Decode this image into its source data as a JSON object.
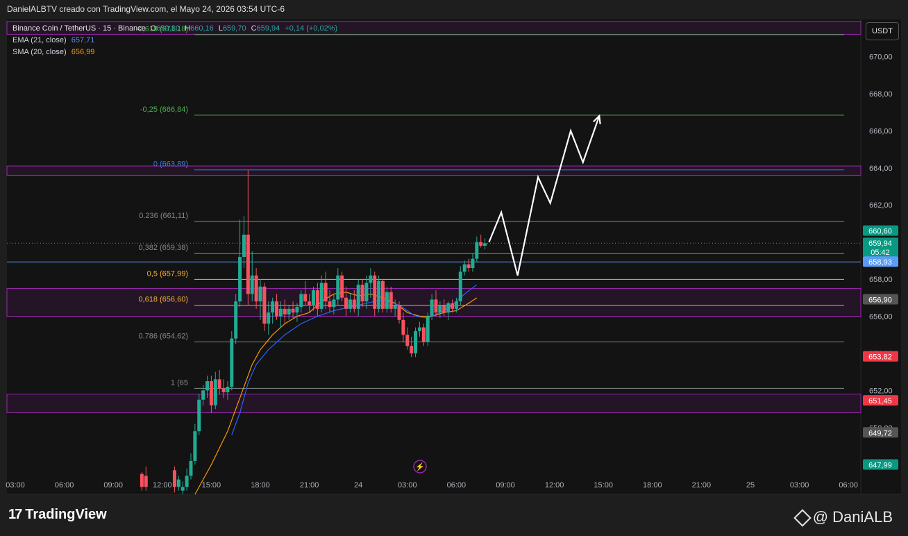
{
  "header": {
    "attribution": "DanielALBTV creado con TradingView.com, el Mayo 24, 2026 03:54 UTC-6"
  },
  "legend": {
    "symbol": "Binance Coin / TetherUS · 15 · Binance",
    "ohlc": {
      "o_label": "O",
      "o": "659,80",
      "h_label": "H",
      "h": "660,16",
      "l_label": "L",
      "l": "659,70",
      "c_label": "C",
      "c": "659,94",
      "change": "+0,14 (+0,02%)"
    },
    "ema": {
      "label": "EMA (21, close)",
      "value": "657,71"
    },
    "sma": {
      "label": "SMA (20, close)",
      "value": "656,99"
    }
  },
  "unit_button": "USDT",
  "footer": {
    "brand": "TradingView",
    "brand_mark": "17",
    "author": "@ DaniALB"
  },
  "colors": {
    "background": "#131313",
    "up": "#22ab94",
    "down": "#f7525f",
    "ema": "#2962ff",
    "sma": "#ff9800",
    "zone": "#9c27b0",
    "fib_green": "#4caf50",
    "fib_blue": "#3a7ff0",
    "fib_orange": "#f5b335",
    "projection": "#ffffff",
    "price_green": "#089981"
  },
  "icons": {
    "flash": "lightning-icon"
  },
  "chart_data": {
    "type": "candlestick",
    "y_axis": {
      "min": 646.4,
      "max": 672.0,
      "ticks": [
        "670,00",
        "668,00",
        "666,00",
        "664,00",
        "662,00",
        "660,00",
        "658,00",
        "656,00",
        "654,00",
        "652,00",
        "650,00"
      ]
    },
    "x_axis": {
      "ticks": [
        "03:00",
        "06:00",
        "09:00",
        "12:00",
        "15:00",
        "18:00",
        "21:00",
        "24",
        "03:00",
        "06:00",
        "09:00",
        "12:00",
        "15:00",
        "18:00",
        "21:00",
        "25",
        "03:00",
        "06:00"
      ]
    },
    "candles": [
      {
        "t": 7.75,
        "o": 647.5,
        "h": 647.6,
        "l": 646.6,
        "c": 646.8
      },
      {
        "t": 8.0,
        "o": 647.4,
        "h": 647.9,
        "l": 646.6,
        "c": 646.8
      },
      {
        "t": 9.75,
        "o": 647.7,
        "h": 647.9,
        "l": 646.5,
        "c": 646.8
      },
      {
        "t": 10.0,
        "o": 646.8,
        "h": 647.4,
        "l": 646.6,
        "c": 647.2
      },
      {
        "t": 10.25,
        "o": 646.6,
        "h": 647.1,
        "l": 646.4,
        "c": 646.8
      },
      {
        "t": 10.5,
        "o": 646.8,
        "h": 647.8,
        "l": 646.6,
        "c": 647.4
      },
      {
        "t": 10.75,
        "o": 647.4,
        "h": 648.6,
        "l": 647.2,
        "c": 648.2
      },
      {
        "t": 11.0,
        "o": 648.2,
        "h": 650.2,
        "l": 648.0,
        "c": 649.8
      },
      {
        "t": 11.25,
        "o": 649.8,
        "h": 651.8,
        "l": 649.6,
        "c": 651.5
      },
      {
        "t": 11.5,
        "o": 651.5,
        "h": 652.3,
        "l": 651.2,
        "c": 652.0
      },
      {
        "t": 11.75,
        "o": 652.0,
        "h": 652.8,
        "l": 651.6,
        "c": 652.5
      },
      {
        "t": 12.0,
        "o": 652.5,
        "h": 652.8,
        "l": 650.8,
        "c": 651.2
      },
      {
        "t": 12.25,
        "o": 651.2,
        "h": 653.0,
        "l": 651.0,
        "c": 652.6
      },
      {
        "t": 12.5,
        "o": 652.6,
        "h": 653.1,
        "l": 651.8,
        "c": 652.1
      },
      {
        "t": 12.75,
        "o": 652.1,
        "h": 652.6,
        "l": 651.6,
        "c": 651.9
      },
      {
        "t": 13.0,
        "o": 651.9,
        "h": 652.5,
        "l": 651.5,
        "c": 652.2
      },
      {
        "t": 13.25,
        "o": 652.2,
        "h": 655.2,
        "l": 652.0,
        "c": 654.8
      },
      {
        "t": 13.5,
        "o": 654.8,
        "h": 657.2,
        "l": 654.5,
        "c": 656.8
      },
      {
        "t": 13.75,
        "o": 656.8,
        "h": 661.2,
        "l": 656.5,
        "c": 659.2
      },
      {
        "t": 14.0,
        "o": 659.2,
        "h": 661.4,
        "l": 658.6,
        "c": 660.4
      },
      {
        "t": 14.25,
        "o": 660.4,
        "h": 663.9,
        "l": 656.6,
        "c": 657.2
      },
      {
        "t": 14.5,
        "o": 657.2,
        "h": 659.5,
        "l": 656.8,
        "c": 658.2
      },
      {
        "t": 14.75,
        "o": 658.2,
        "h": 658.6,
        "l": 656.4,
        "c": 656.8
      },
      {
        "t": 15.0,
        "o": 656.8,
        "h": 658.0,
        "l": 655.8,
        "c": 657.6
      },
      {
        "t": 15.25,
        "o": 657.6,
        "h": 657.8,
        "l": 655.2,
        "c": 655.6
      },
      {
        "t": 15.5,
        "o": 655.6,
        "h": 656.8,
        "l": 655.0,
        "c": 656.2
      },
      {
        "t": 15.75,
        "o": 656.2,
        "h": 657.0,
        "l": 655.6,
        "c": 656.8
      },
      {
        "t": 16.0,
        "o": 656.8,
        "h": 657.2,
        "l": 655.8,
        "c": 656.0
      },
      {
        "t": 16.25,
        "o": 656.0,
        "h": 656.8,
        "l": 655.4,
        "c": 656.4
      },
      {
        "t": 16.5,
        "o": 656.4,
        "h": 656.9,
        "l": 655.6,
        "c": 656.1
      },
      {
        "t": 16.75,
        "o": 656.1,
        "h": 656.6,
        "l": 655.8,
        "c": 656.4
      },
      {
        "t": 17.0,
        "o": 656.4,
        "h": 656.8,
        "l": 655.9,
        "c": 656.2
      },
      {
        "t": 17.25,
        "o": 656.2,
        "h": 656.7,
        "l": 655.7,
        "c": 656.5
      },
      {
        "t": 17.5,
        "o": 656.5,
        "h": 657.4,
        "l": 656.2,
        "c": 657.2
      },
      {
        "t": 17.75,
        "o": 657.2,
        "h": 657.9,
        "l": 656.6,
        "c": 656.8
      },
      {
        "t": 18.0,
        "o": 656.8,
        "h": 657.2,
        "l": 656.2,
        "c": 656.6
      },
      {
        "t": 18.25,
        "o": 656.6,
        "h": 657.6,
        "l": 656.3,
        "c": 657.4
      },
      {
        "t": 18.5,
        "o": 657.4,
        "h": 657.8,
        "l": 656.0,
        "c": 656.4
      },
      {
        "t": 18.75,
        "o": 656.4,
        "h": 658.2,
        "l": 656.2,
        "c": 657.8
      },
      {
        "t": 19.0,
        "o": 657.8,
        "h": 658.4,
        "l": 656.4,
        "c": 656.8
      },
      {
        "t": 19.25,
        "o": 656.8,
        "h": 657.4,
        "l": 656.2,
        "c": 656.5
      },
      {
        "t": 19.5,
        "o": 656.5,
        "h": 657.2,
        "l": 656.1,
        "c": 656.9
      },
      {
        "t": 19.75,
        "o": 656.9,
        "h": 658.6,
        "l": 656.6,
        "c": 658.2
      },
      {
        "t": 20.0,
        "o": 658.2,
        "h": 658.4,
        "l": 656.8,
        "c": 657.0
      },
      {
        "t": 20.25,
        "o": 657.0,
        "h": 657.6,
        "l": 656.0,
        "c": 656.4
      },
      {
        "t": 20.5,
        "o": 656.4,
        "h": 657.2,
        "l": 656.2,
        "c": 656.9
      },
      {
        "t": 20.75,
        "o": 656.9,
        "h": 657.4,
        "l": 656.2,
        "c": 656.4
      },
      {
        "t": 21.0,
        "o": 656.4,
        "h": 658.0,
        "l": 656.0,
        "c": 657.7
      },
      {
        "t": 21.25,
        "o": 657.7,
        "h": 658.0,
        "l": 656.5,
        "c": 656.8
      },
      {
        "t": 21.5,
        "o": 656.8,
        "h": 658.2,
        "l": 656.4,
        "c": 657.8
      },
      {
        "t": 21.75,
        "o": 657.8,
        "h": 658.6,
        "l": 657.0,
        "c": 658.2
      },
      {
        "t": 22.0,
        "o": 658.2,
        "h": 658.4,
        "l": 656.0,
        "c": 656.4
      },
      {
        "t": 22.25,
        "o": 656.4,
        "h": 658.2,
        "l": 656.2,
        "c": 657.9
      },
      {
        "t": 22.5,
        "o": 657.9,
        "h": 658.0,
        "l": 656.2,
        "c": 656.4
      },
      {
        "t": 22.75,
        "o": 656.4,
        "h": 657.6,
        "l": 656.2,
        "c": 657.3
      },
      {
        "t": 23.0,
        "o": 657.3,
        "h": 657.6,
        "l": 656.2,
        "c": 656.4
      },
      {
        "t": 23.25,
        "o": 656.4,
        "h": 656.9,
        "l": 656.0,
        "c": 656.6
      },
      {
        "t": 23.5,
        "o": 656.6,
        "h": 656.8,
        "l": 655.6,
        "c": 655.8
      },
      {
        "t": 23.75,
        "o": 655.8,
        "h": 656.2,
        "l": 654.6,
        "c": 655.0
      },
      {
        "t": 24.0,
        "o": 655.0,
        "h": 655.4,
        "l": 654.2,
        "c": 654.4
      },
      {
        "t": 24.25,
        "o": 654.4,
        "h": 654.9,
        "l": 653.8,
        "c": 654.0
      },
      {
        "t": 24.5,
        "o": 654.0,
        "h": 655.4,
        "l": 653.8,
        "c": 655.2
      },
      {
        "t": 24.75,
        "o": 655.2,
        "h": 655.7,
        "l": 654.9,
        "c": 655.4
      },
      {
        "t": 25.0,
        "o": 655.4,
        "h": 655.6,
        "l": 654.4,
        "c": 654.6
      },
      {
        "t": 25.25,
        "o": 654.6,
        "h": 656.2,
        "l": 654.4,
        "c": 656.0
      },
      {
        "t": 25.5,
        "o": 656.0,
        "h": 657.2,
        "l": 655.8,
        "c": 656.9
      },
      {
        "t": 25.75,
        "o": 656.9,
        "h": 657.4,
        "l": 656.0,
        "c": 656.2
      },
      {
        "t": 26.0,
        "o": 656.2,
        "h": 656.8,
        "l": 655.9,
        "c": 656.6
      },
      {
        "t": 26.25,
        "o": 656.6,
        "h": 656.9,
        "l": 656.0,
        "c": 656.2
      },
      {
        "t": 26.5,
        "o": 656.2,
        "h": 656.8,
        "l": 655.8,
        "c": 656.7
      },
      {
        "t": 26.75,
        "o": 656.7,
        "h": 656.9,
        "l": 656.2,
        "c": 656.4
      },
      {
        "t": 27.0,
        "o": 656.4,
        "h": 657.0,
        "l": 656.2,
        "c": 656.8
      },
      {
        "t": 27.25,
        "o": 656.8,
        "h": 658.7,
        "l": 656.6,
        "c": 658.4
      },
      {
        "t": 27.5,
        "o": 658.4,
        "h": 659.0,
        "l": 658.2,
        "c": 658.8
      },
      {
        "t": 27.75,
        "o": 658.8,
        "h": 659.1,
        "l": 658.4,
        "c": 658.6
      },
      {
        "t": 28.0,
        "o": 658.6,
        "h": 659.4,
        "l": 658.4,
        "c": 659.1
      },
      {
        "t": 28.25,
        "o": 659.1,
        "h": 660.3,
        "l": 658.9,
        "c": 660.0
      },
      {
        "t": 28.5,
        "o": 660.0,
        "h": 660.4,
        "l": 659.7,
        "c": 659.8
      },
      {
        "t": 28.75,
        "o": 659.8,
        "h": 660.2,
        "l": 659.6,
        "c": 659.94
      }
    ],
    "ema": [
      [
        13.25,
        649.6
      ],
      [
        13.75,
        650.8
      ],
      [
        14.25,
        652.4
      ],
      [
        14.75,
        653.4
      ],
      [
        15.5,
        654.2
      ],
      [
        16.5,
        655.0
      ],
      [
        17.5,
        655.6
      ],
      [
        18.5,
        656.0
      ],
      [
        19.5,
        656.3
      ],
      [
        20.5,
        656.5
      ],
      [
        21.5,
        656.7
      ],
      [
        22.5,
        656.9
      ],
      [
        23.5,
        656.6
      ],
      [
        24.5,
        656.0
      ],
      [
        25.25,
        655.9
      ],
      [
        26.0,
        656.2
      ],
      [
        26.75,
        656.6
      ],
      [
        27.5,
        657.2
      ],
      [
        28.25,
        657.7
      ]
    ],
    "sma": [
      [
        11.0,
        646.4
      ],
      [
        12.0,
        648.0
      ],
      [
        13.0,
        649.8
      ],
      [
        13.5,
        651.0
      ],
      [
        14.0,
        652.2
      ],
      [
        14.5,
        653.4
      ],
      [
        15.0,
        654.2
      ],
      [
        15.75,
        655.0
      ],
      [
        16.5,
        655.6
      ],
      [
        17.25,
        656.0
      ],
      [
        18.0,
        656.2
      ],
      [
        18.75,
        656.8
      ],
      [
        19.5,
        657.2
      ],
      [
        20.25,
        657.3
      ],
      [
        21.0,
        657.1
      ],
      [
        21.75,
        657.2
      ],
      [
        22.5,
        657.0
      ],
      [
        23.25,
        656.7
      ],
      [
        24.0,
        656.2
      ],
      [
        24.75,
        656.0
      ],
      [
        25.5,
        656.0
      ],
      [
        26.25,
        656.2
      ],
      [
        27.0,
        656.3
      ],
      [
        27.75,
        656.7
      ],
      [
        28.25,
        656.99
      ]
    ],
    "fib_levels": [
      {
        "label": "-0,618 (671,18)",
        "price": 671.18,
        "color": "#4caf50"
      },
      {
        "label": "-0,25 (666,84)",
        "price": 666.84,
        "color": "#4caf50"
      },
      {
        "label": "0 (663,89)",
        "price": 663.89,
        "color": "#3a7ff0"
      },
      {
        "label": "0.236 (661,11)",
        "price": 661.11,
        "color": "#888888"
      },
      {
        "label": "0,382 (659,38)",
        "price": 659.38,
        "color": "#888888"
      },
      {
        "label": "0,5 (657,99)",
        "price": 657.99,
        "color": "#f5b335"
      },
      {
        "label": "0,618 (656,60)",
        "price": 656.6,
        "color": "#f5b335"
      },
      {
        "label": "0.786 (654,62)",
        "price": 654.62,
        "color": "#888888"
      },
      {
        "label": "1 (65",
        "price": 652.11,
        "color": "#888888"
      }
    ],
    "zones": [
      [
        671.2,
        671.9
      ],
      [
        663.6,
        664.1
      ],
      [
        656.0,
        657.5
      ],
      [
        650.8,
        651.8
      ]
    ],
    "horizontal_lines": [
      {
        "price": 658.93,
        "color": "#5b9cf6"
      }
    ],
    "projection": [
      [
        29.0,
        660.0
      ],
      [
        29.75,
        661.6
      ],
      [
        30.75,
        658.2
      ],
      [
        32.0,
        663.5
      ],
      [
        32.75,
        662.1
      ],
      [
        34.0,
        666.0
      ],
      [
        34.75,
        664.3
      ],
      [
        35.75,
        666.8
      ]
    ],
    "price_labels": [
      {
        "price": 660.6,
        "text": "660,60",
        "color": "#089981"
      },
      {
        "price": 659.94,
        "text": "659,94",
        "color": "#089981",
        "extra": "05:42"
      },
      {
        "price": 658.93,
        "text": "658,93",
        "color": "#5b9cf6"
      },
      {
        "price": 656.9,
        "text": "656,90",
        "color": "#555555"
      },
      {
        "price": 653.82,
        "text": "653,82",
        "color": "#f23645"
      },
      {
        "price": 651.45,
        "text": "651,45",
        "color": "#f23645"
      },
      {
        "price": 649.72,
        "text": "649,72",
        "color": "#555555"
      },
      {
        "price": 647.99,
        "text": "647,99",
        "color": "#089981"
      }
    ]
  }
}
